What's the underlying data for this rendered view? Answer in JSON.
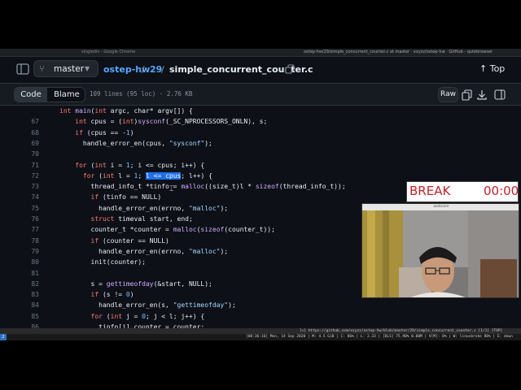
{
  "window": {
    "left_title": "singlediv - Google Chrome",
    "main_title": "ostep-hw/29/simple_concurrent_counter.c at master · xxyzz/ostep-hw · GitHub - qutebrowser"
  },
  "header": {
    "branch": "master",
    "breadcrumb": {
      "repo": "ostep-hw",
      "sep": "/",
      "dir": "29",
      "file": "simple_concurrent_counter.c"
    },
    "top_label": "Top"
  },
  "file_toolbar": {
    "code_tab": "Code",
    "blame_tab": "Blame",
    "info": "109 lines (95 loc) · 2.76 KB",
    "raw_label": "Raw"
  },
  "code": {
    "lines": [
      {
        "n": "",
        "t": "int main(int argc, char* argv[]) {"
      },
      {
        "n": "67",
        "t": "    int cpus = (int)sysconf(_SC_NPROCESSORS_ONLN), s;"
      },
      {
        "n": "68",
        "t": "    if (cpus == -1)"
      },
      {
        "n": "69",
        "t": "      handle_error_en(cpus, \"sysconf\");"
      },
      {
        "n": "70",
        "t": ""
      },
      {
        "n": "71",
        "t": "    for (int i = 1; i <= cpus; i++) {"
      },
      {
        "n": "72",
        "t": "      for (int l = 1; l <= cpus; l++) {"
      },
      {
        "n": "73",
        "t": "        thread_info_t *tinfo = malloc((size_t)l * sizeof(thread_info_t));"
      },
      {
        "n": "74",
        "t": "        if (tinfo == NULL)"
      },
      {
        "n": "75",
        "t": "          handle_error_en(errno, \"malloc\");"
      },
      {
        "n": "76",
        "t": "        struct timeval start, end;"
      },
      {
        "n": "77",
        "t": "        counter_t *counter = malloc(sizeof(counter_t));"
      },
      {
        "n": "78",
        "t": "        if (counter == NULL)"
      },
      {
        "n": "79",
        "t": "          handle_error_en(errno, \"malloc\");"
      },
      {
        "n": "80",
        "t": "        init(counter);"
      },
      {
        "n": "81",
        "t": ""
      },
      {
        "n": "82",
        "t": "        s = gettimeofday(&start, NULL);"
      },
      {
        "n": "83",
        "t": "        if (s != 0)"
      },
      {
        "n": "84",
        "t": "          handle_error_en(s, \"gettimeofday\");"
      },
      {
        "n": "85",
        "t": "        for (int j = 0; j < l; j++) {"
      },
      {
        "n": "86",
        "t": "          tinfo[j].counter = counter;"
      }
    ],
    "selection": "l <= cpus"
  },
  "status": {
    "url": "[<] https://github.com/xxyzz/ostep-hw/blob/master/29/simple_concurrent_counter.c [1/1] [TOP]",
    "workspace": "2",
    "system": "[08:36:16] Mon, 14 Sep 2020 | M: 4.5 GiB | C: 06% | L: 2.33 | [DLS] 75.90% 0.00M | V[M]: 0% | W: linuxbroke 88% | E: down"
  },
  "break_timer": {
    "label": "BREAK",
    "time": "00:00"
  },
  "webcam": {
    "title": "webcam"
  },
  "colors": {
    "accent_link": "#58a6ff",
    "selection": "#1f6feb",
    "keyword": "#ff7b72",
    "function": "#d2a8ff",
    "string": "#a5d6ff",
    "timer": "#c0202a"
  }
}
